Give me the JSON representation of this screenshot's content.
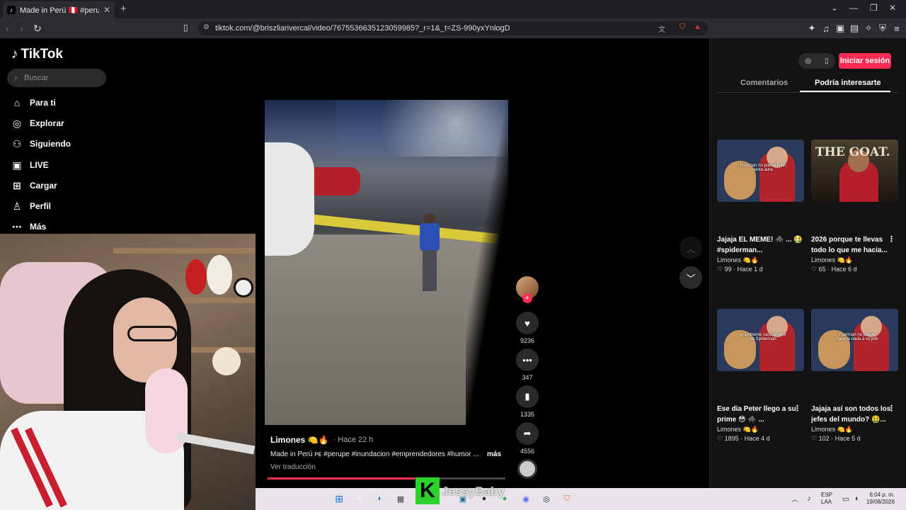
{
  "browser": {
    "tab_title": "Made in Perú 🇵🇪 #perupe #inundac",
    "tab_favicon": "tiktok-icon",
    "new_tab": "+",
    "url": "tiktok.com/@briszliarivercal/video/7675536635123059985?_r=1&_t=ZS-990yxYnlogD"
  },
  "app": {
    "logo_text": "TikTok",
    "search_placeholder": "Buscar"
  },
  "nav": [
    {
      "label": "Para ti",
      "icon": "home-icon",
      "glyph": "⌂"
    },
    {
      "label": "Explorar",
      "icon": "compass-icon",
      "glyph": "◎"
    },
    {
      "label": "Siguiendo",
      "icon": "following-icon",
      "glyph": "⚇"
    },
    {
      "label": "LIVE",
      "icon": "live-icon",
      "glyph": "▣"
    },
    {
      "label": "Cargar",
      "icon": "upload-icon",
      "glyph": "⊞"
    },
    {
      "label": "Perfil",
      "icon": "profile-icon",
      "glyph": "♙"
    },
    {
      "label": "Más",
      "icon": "more-icon",
      "glyph": "⋯"
    }
  ],
  "video": {
    "author": "Limones 🍋🔥",
    "time": "· Hace 22 h",
    "description": "Made in Perú ᴘᴇ #perupe #inundacion #emprendedores #humor ...",
    "more_label": "más",
    "translate_label": "Ver traducción",
    "progress": 0.62
  },
  "actions": {
    "likes": "9236",
    "comments": "347",
    "saves": "1335",
    "shares": "4556"
  },
  "header_right": {
    "login_label": "Iniciar sesión"
  },
  "tabs": {
    "comments": "Comentarios",
    "suggested": "Podría interesarte"
  },
  "suggested": [
    {
      "title": "Jajaja EL MEME! 🕷️ ... 🤮 #spiderman...",
      "user": "Limones 🍋🔥",
      "likes": "99",
      "time": "Hace 1 d",
      "caption": "Fuerman no puede lidiar tanta aura"
    },
    {
      "title": "2026 porque te llevas todo lo que me hacia...",
      "user": "Limones 🍋🔥",
      "likes": "65",
      "time": "Hace 6 d",
      "caption": "THE GOAT."
    },
    {
      "title": "Ese dia Peter llego a su prime 😳 🕷️ ...",
      "user": "Limones 🍋🔥",
      "likes": "1895",
      "time": "Hace 4 d",
      "caption": "el ambiente sacó lo peor de Spiderman"
    },
    {
      "title": "Jajaja así son todos los jefes del mundo? 🤮...",
      "user": "Limones 🍋🔥",
      "likes": "102",
      "time": "Hace 5 d",
      "caption": "Fuerman no puede hacerle nada a su jefe"
    }
  ],
  "overlay": {
    "brand_letter": "K",
    "streamer_name": "JessyBaby"
  },
  "taskbar": {
    "lang_top": "ESP",
    "lang_bottom": "LAA",
    "time": "6:04 p. m.",
    "date": "19/08/2026"
  },
  "colors": {
    "accent": "#fe2c55",
    "overlay_green": "#2bd42b"
  }
}
